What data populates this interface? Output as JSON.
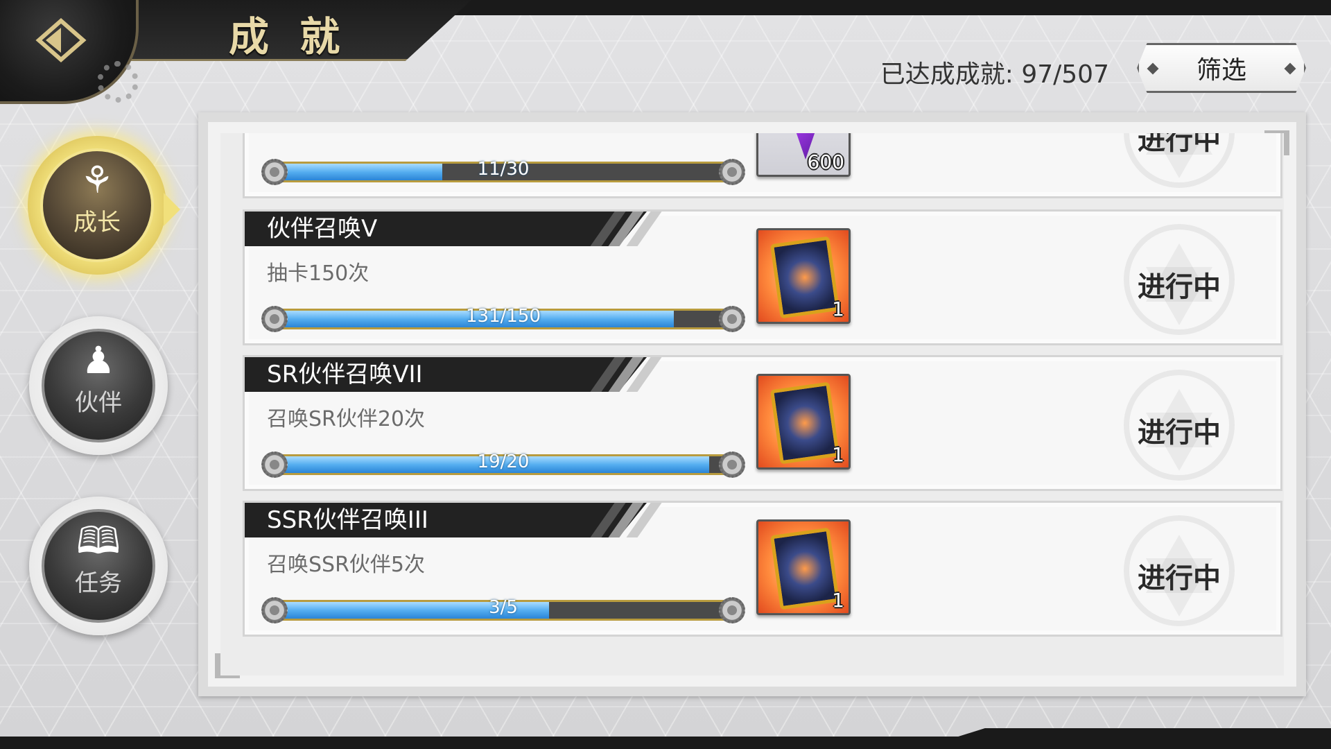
{
  "header": {
    "title": "成 就",
    "achieved_label": "已达成成就:  97/507",
    "filter_label": "筛选"
  },
  "nav": {
    "items": [
      {
        "label": "成长",
        "icon": "hooded-figure-icon",
        "active": true
      },
      {
        "label": "伙伴",
        "icon": "group-icon",
        "active": false
      },
      {
        "label": "任务",
        "icon": "book-flame-icon",
        "active": false
      }
    ]
  },
  "achievements": [
    {
      "title": "",
      "desc": "",
      "progress_text": "11/30",
      "progress": 0.367,
      "reward": {
        "type": "gem",
        "qty": "600"
      },
      "status": "进行中"
    },
    {
      "title": "伙伴召唤V",
      "desc": "抽卡150次",
      "progress_text": "131/150",
      "progress": 0.873,
      "reward": {
        "type": "card",
        "qty": "1"
      },
      "status": "进行中"
    },
    {
      "title": "SR伙伴召唤VII",
      "desc": "召唤SR伙伴20次",
      "progress_text": "19/20",
      "progress": 0.95,
      "reward": {
        "type": "card",
        "qty": "1"
      },
      "status": "进行中"
    },
    {
      "title": "SSR伙伴召唤III",
      "desc": "召唤SSR伙伴5次",
      "progress_text": "3/5",
      "progress": 0.6,
      "reward": {
        "type": "card",
        "qty": "1"
      },
      "status": "进行中"
    }
  ],
  "colors": {
    "progress_fill": "#55aef0",
    "gold": "#b89b3e",
    "title_bg": "#222222"
  }
}
